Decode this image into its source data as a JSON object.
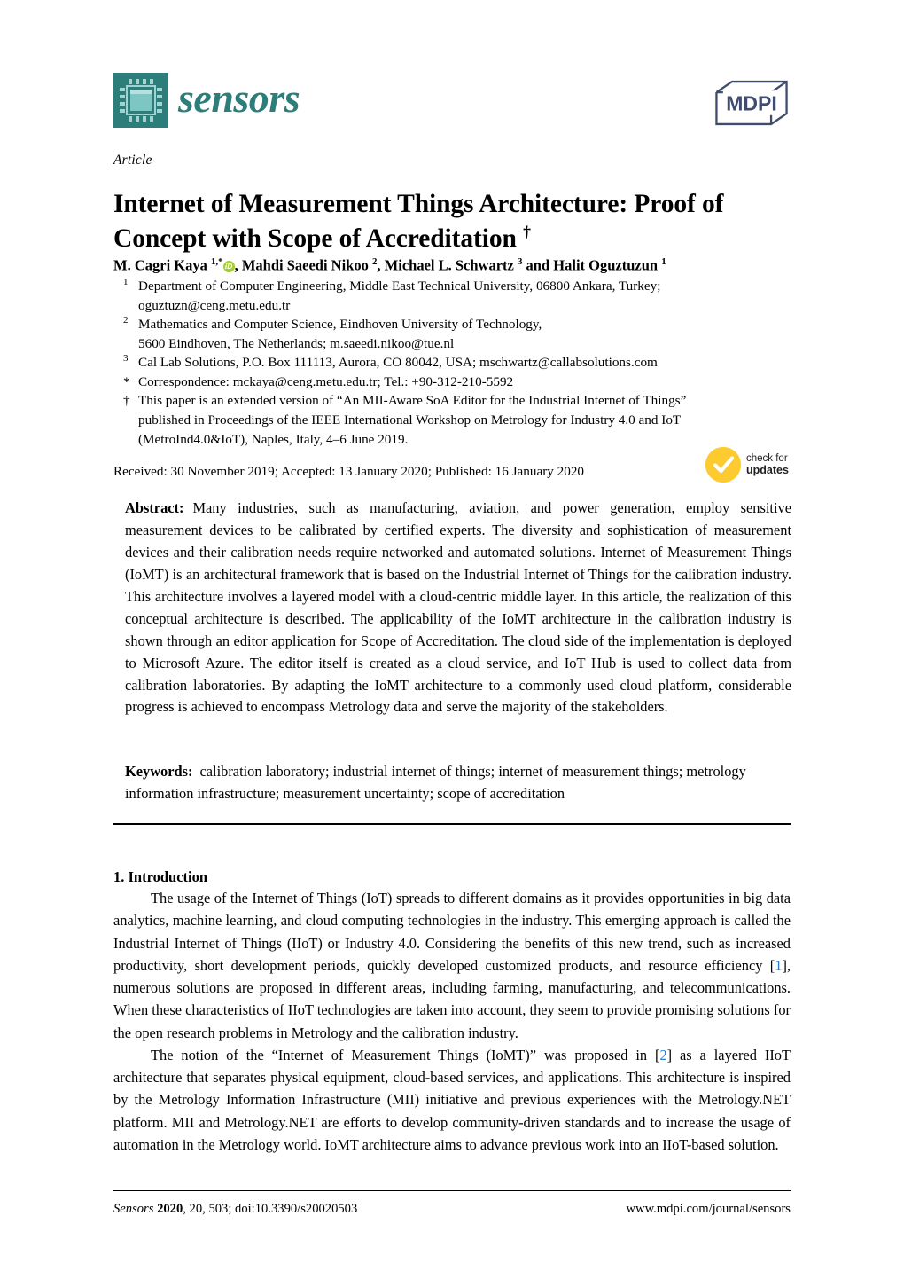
{
  "journal": {
    "name": "sensors",
    "logo_icon": "microchip-icon",
    "publisher": "MDPI",
    "brand_color": "#2d7d7b",
    "publisher_color": "#3f4c6b"
  },
  "article": {
    "kicker": "Article",
    "title": "Internet of Measurement Things Architecture: Proof of Concept with Scope of Accreditation",
    "title_dagger": "†",
    "authors_line": {
      "a1_name": "M. Cagri Kaya",
      "a1_sup": "1,*",
      "a1_orcid": "iD",
      "a2_name": "Mahdi Saeedi Nikoo",
      "a2_sup": "2",
      "a3_name": "Michael L. Schwartz",
      "a3_sup": "3",
      "conjunction": "and",
      "a4_name": "Halit Oguztuzun",
      "a4_sup": "1",
      "sep": ", "
    },
    "affiliations": [
      {
        "marker": "1",
        "lines": [
          "Department of Computer Engineering, Middle East Technical University, 06800 Ankara, Turkey;",
          "oguztuzn@ceng.metu.edu.tr"
        ]
      },
      {
        "marker": "2",
        "lines": [
          "Mathematics and Computer Science, Eindhoven University of Technology,",
          "5600 Eindhoven, The Netherlands; m.saeedi.nikoo@tue.nl"
        ]
      },
      {
        "marker": "3",
        "lines": [
          "Cal Lab Solutions, P.O. Box 111113, Aurora, CO 80042, USA; mschwartz@callabsolutions.com"
        ]
      },
      {
        "marker": "*",
        "lines": [
          "Correspondence: mckaya@ceng.metu.edu.tr; Tel.: +90-312-210-5592"
        ]
      },
      {
        "marker": "†",
        "lines": [
          "This paper is an extended version of “An MII-Aware SoA Editor for the Industrial Internet of Things”",
          "published in Proceedings of the IEEE International Workshop on Metrology for Industry 4.0 and IoT",
          "(MetroInd4.0&IoT), Naples, Italy, 4–6 June 2019."
        ]
      }
    ],
    "history": "Received: 30 November 2019; Accepted: 13 January 2020; Published: 16 January 2020",
    "crossmark": {
      "line1": "check for",
      "line2": "updates",
      "badge_color": "#fdcb2f"
    }
  },
  "abstract": {
    "label": "Abstract:",
    "text": "Many industries, such as manufacturing, aviation, and power generation, employ sensitive measurement devices to be calibrated by certified experts. The diversity and sophistication of measurement devices and their calibration needs require networked and automated solutions. Internet of Measurement Things (IoMT) is an architectural framework that is based on the Industrial Internet of Things for the calibration industry. This architecture involves a layered model with a cloud-centric middle layer. In this article, the realization of this conceptual architecture is described. The applicability of the IoMT architecture in the calibration industry is shown through an editor application for Scope of Accreditation. The cloud side of the implementation is deployed to Microsoft Azure. The editor itself is created as a cloud service, and IoT Hub is used to collect data from calibration laboratories. By adapting the IoMT architecture to a commonly used cloud platform, considerable progress is achieved to encompass Metrology data and serve the majority of the stakeholders."
  },
  "keywords": {
    "label": "Keywords:",
    "text": "calibration laboratory; industrial internet of things; internet of measurement things; metrology information infrastructure; measurement uncertainty; scope of accreditation"
  },
  "introduction": {
    "heading": "1. Introduction",
    "paragraph1_part1": "The usage of the Internet of Things (IoT) spreads to different domains as it provides opportunities in big data analytics, machine learning, and cloud computing technologies in the industry. This emerging approach is called the Industrial Internet of Things (IIoT) or Industry 4.0. Considering the benefits of this new trend, such as increased productivity, short development periods, quickly developed customized products, and resource efficiency [",
    "paragraph1_cite": "1",
    "paragraph1_part2": "], numerous solutions are proposed in different areas, including farming, manufacturing, and telecommunications. When these characteristics of IIoT technologies are taken into account, they seem to provide promising solutions for the open research problems in Metrology and the calibration industry.",
    "paragraph2_part1": "The notion of the “Internet of Measurement Things (IoMT)” was proposed in [",
    "paragraph2_cite": "2",
    "paragraph2_part2": "] as a layered IIoT architecture that separates physical equipment, cloud-based services, and applications. This architecture is inspired by the Metrology Information Infrastructure (MII) initiative and previous experiences with the Metrology.NET platform. MII and Metrology.NET are efforts to develop community-driven standards and to increase the usage of automation in the Metrology world. IoMT architecture aims to advance previous work into an IIoT-based solution."
  },
  "footer": {
    "journal_italic": "Sensors",
    "year": "2020",
    "volume_issue": ", 20, 503; doi:10.3390/s20020503",
    "url": "www.mdpi.com/journal/sensors"
  }
}
